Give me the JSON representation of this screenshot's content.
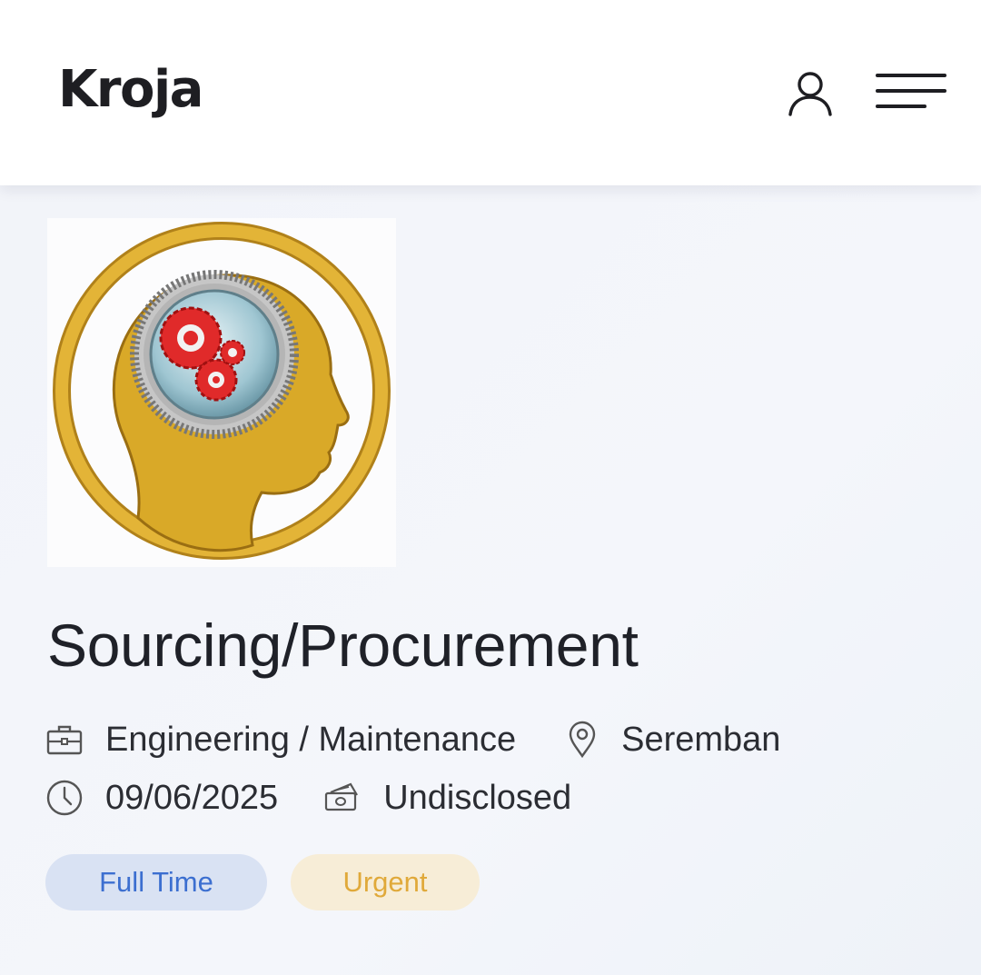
{
  "header": {
    "brand": "Kroja",
    "icons": {
      "account": "user-icon",
      "menu": "hamburger-menu-icon"
    }
  },
  "job": {
    "logo_icon": "head-with-gears-logo",
    "title": "Sourcing/Procurement",
    "category": "Engineering / Maintenance",
    "location": "Seremban",
    "date": "09/06/2025",
    "salary": "Undisclosed",
    "tags": [
      {
        "label": "Full Time",
        "color": "#3c6fd0",
        "bg": "#d9e2f3"
      },
      {
        "label": "Urgent",
        "color": "#e0a93a",
        "bg": "#f7edd7"
      }
    ]
  },
  "colors": {
    "logo_gold": "#d9a928",
    "logo_gear_red": "#e02a2a",
    "text": "#1f2128"
  }
}
